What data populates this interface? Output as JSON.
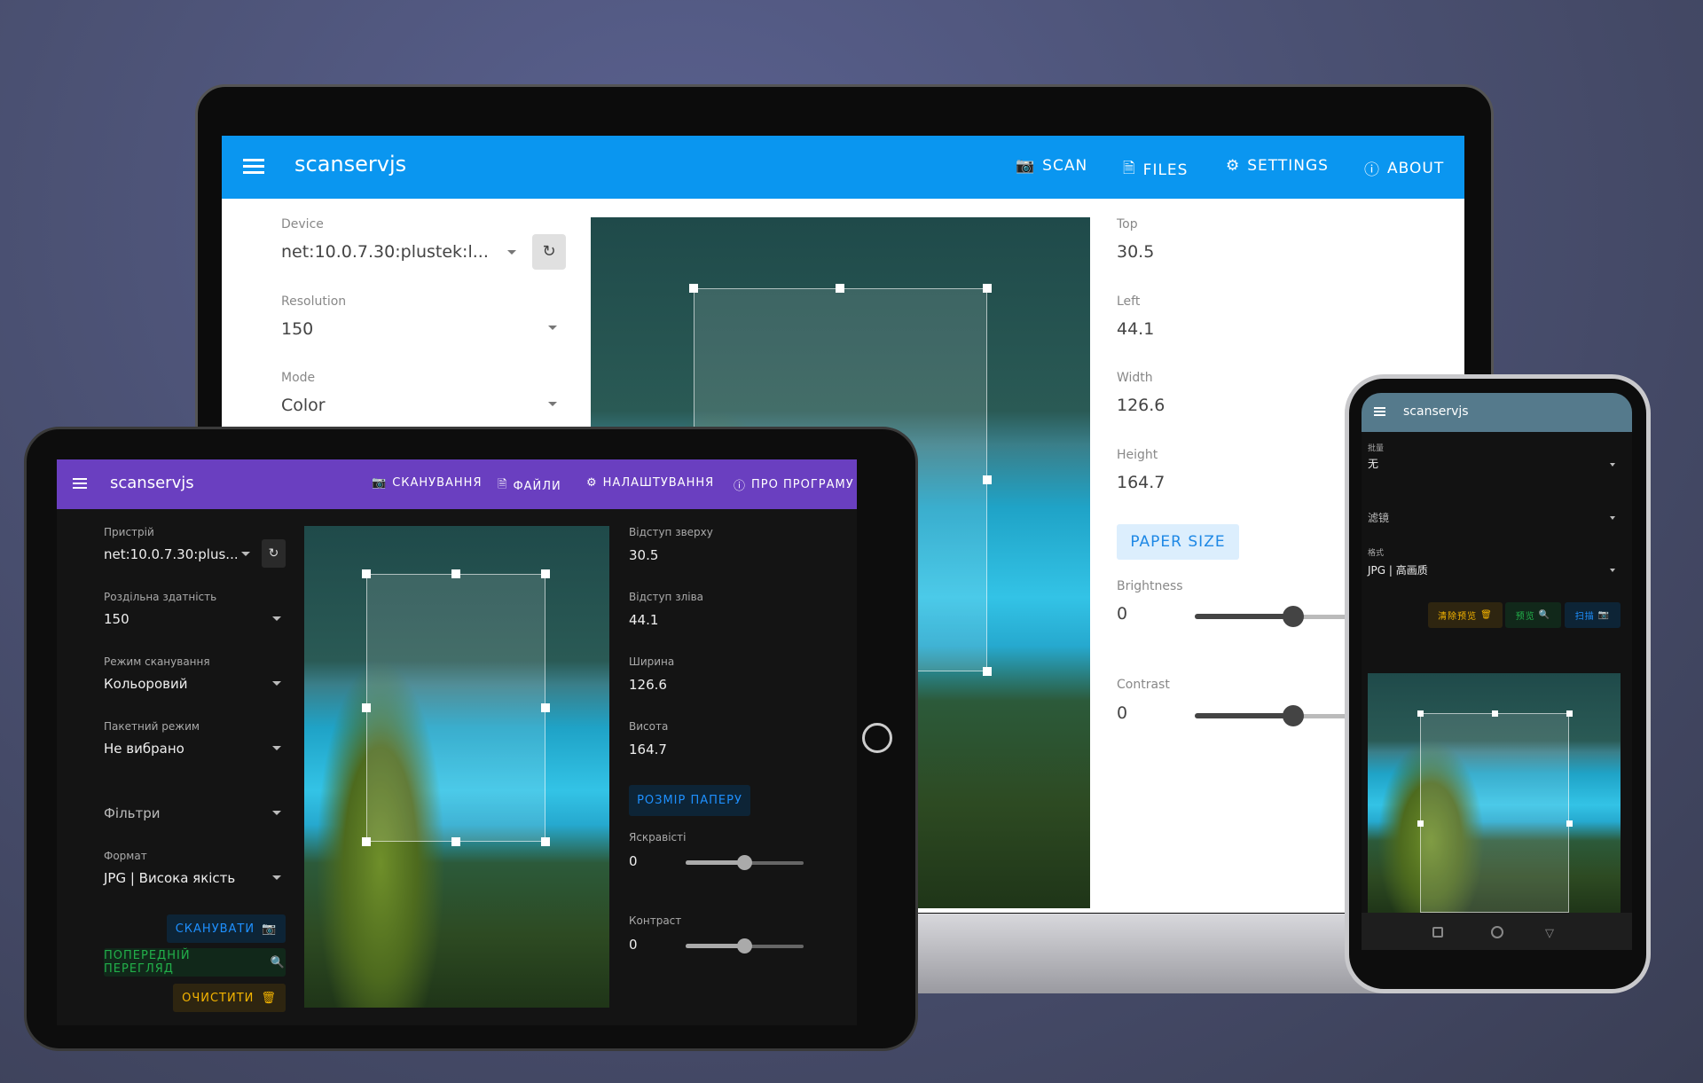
{
  "app_title": "scanservjs",
  "laptop": {
    "nav": [
      {
        "label": "SCAN",
        "icon": "camera-icon"
      },
      {
        "label": "FILES",
        "icon": "file-icon"
      },
      {
        "label": "SETTINGS",
        "icon": "gear-icon"
      },
      {
        "label": "ABOUT",
        "icon": "info-icon"
      }
    ],
    "device": {
      "label": "Device",
      "value": "net:10.0.7.30:plustek:l..."
    },
    "resolution": {
      "label": "Resolution",
      "value": "150"
    },
    "mode": {
      "label": "Mode",
      "value": "Color"
    },
    "top": {
      "label": "Top",
      "value": "30.5"
    },
    "left": {
      "label": "Left",
      "value": "44.1"
    },
    "width": {
      "label": "Width",
      "value": "126.6"
    },
    "height": {
      "label": "Height",
      "value": "164.7"
    },
    "paper_size": "PAPER SIZE",
    "brightness": {
      "label": "Brightness",
      "value": "0"
    },
    "contrast": {
      "label": "Contrast",
      "value": "0"
    },
    "header_color": "#0a96f0"
  },
  "tablet": {
    "nav": [
      {
        "label": "СКАНУВАННЯ",
        "icon": "camera-icon"
      },
      {
        "label": "ФАЙЛИ",
        "icon": "file-icon"
      },
      {
        "label": "НАЛАШТУВАННЯ",
        "icon": "gear-icon"
      },
      {
        "label": "ПРО ПРОГРАМУ",
        "icon": "info-icon"
      }
    ],
    "device": {
      "label": "Пристрій",
      "value": "net:10.0.7.30:plus..."
    },
    "resolution": {
      "label": "Роздільна здатність",
      "value": "150"
    },
    "mode": {
      "label": "Режим сканування",
      "value": "Кольоровий"
    },
    "batch": {
      "label": "Пакетний режим",
      "value": "Не вибрано"
    },
    "filters": "Фільтри",
    "format": {
      "label": "Формат",
      "value": "JPG | Висока якість"
    },
    "scan": "СКАНУВАТИ",
    "preview": "ПОПЕРЕДНІЙ ПЕРЕГЛЯД",
    "clear": "ОЧИСТИТИ",
    "top": {
      "label": "Відступ зверху",
      "value": "30.5"
    },
    "left": {
      "label": "Відступ зліва",
      "value": "44.1"
    },
    "width": {
      "label": "Ширина",
      "value": "126.6"
    },
    "height": {
      "label": "Висота",
      "value": "164.7"
    },
    "paper_size": "РОЗМІР ПАПЕРУ",
    "brightness": {
      "label": "Яскравісті",
      "value": "0"
    },
    "contrast": {
      "label": "Контраст",
      "value": "0"
    },
    "header_color": "#6a3fc0"
  },
  "phone": {
    "batch": {
      "label": "批量",
      "value": "无"
    },
    "filters": "滤镜",
    "format": {
      "label": "格式",
      "value": "JPG | 高画质"
    },
    "clear": "清除预览",
    "preview": "预览",
    "scan": "扫描",
    "header_color": "#557a8c"
  }
}
